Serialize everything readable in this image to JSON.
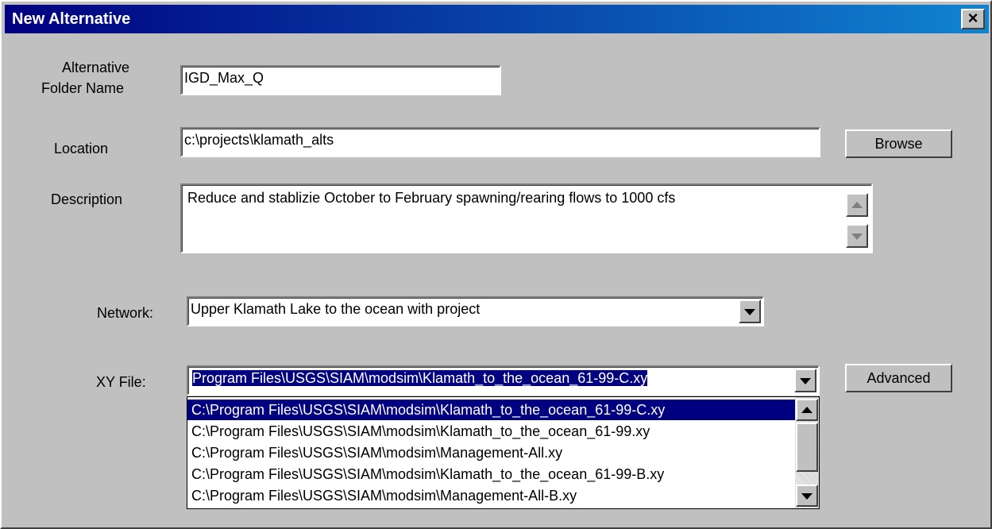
{
  "window": {
    "title": "New Alternative",
    "close_label": "×"
  },
  "form": {
    "folder_label_line1": "Alternative",
    "folder_label_line2": "Folder Name",
    "folder_value": "IGD_Max_Q",
    "location_label": "Location",
    "location_value": "c:\\projects\\klamath_alts",
    "browse_label": "Browse",
    "description_label": "Description",
    "description_value": "Reduce and stablizie October to February spawning/rearing flows to 1000 cfs",
    "network_label": "Network:",
    "network_value": "Upper Klamath Lake to the ocean with project",
    "xy_label": "XY File:",
    "xy_value": "Program Files\\USGS\\SIAM\\modsim\\Klamath_to_the_ocean_61-99-C.xy",
    "advanced_label": "Advanced"
  },
  "xy_options": [
    "C:\\Program Files\\USGS\\SIAM\\modsim\\Klamath_to_the_ocean_61-99-C.xy",
    "C:\\Program Files\\USGS\\SIAM\\modsim\\Klamath_to_the_ocean_61-99.xy",
    "C:\\Program Files\\USGS\\SIAM\\modsim\\Management-All.xy",
    "C:\\Program Files\\USGS\\SIAM\\modsim\\Klamath_to_the_ocean_61-99-B.xy",
    "C:\\Program Files\\USGS\\SIAM\\modsim\\Management-All-B.xy"
  ],
  "selected_index": 0
}
